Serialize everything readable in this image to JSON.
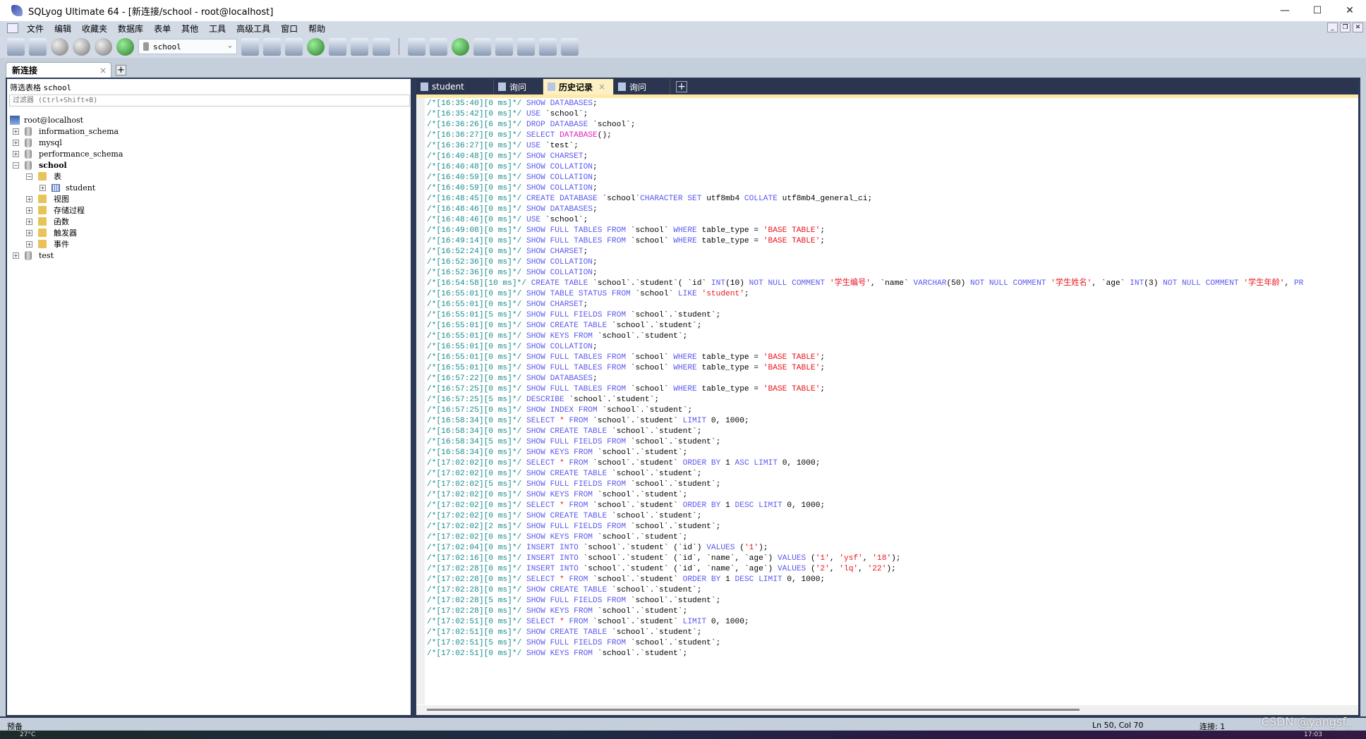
{
  "window": {
    "title": "SQLyog Ultimate 64 - [新连接/school - root@localhost]",
    "controls": [
      "—",
      "☐",
      "✕"
    ]
  },
  "menu": [
    "文件",
    "编辑",
    "收藏夹",
    "数据库",
    "表单",
    "其他",
    "工具",
    "高级工具",
    "窗口",
    "帮助"
  ],
  "toolbar": {
    "database_selector": "school"
  },
  "connection_tab": {
    "label": "新连接",
    "close": "×",
    "add": "+"
  },
  "left_panel": {
    "filter_label": "筛选表格",
    "filter_db": "school",
    "filter_placeholder": "过滤器 (Ctrl+Shift+B)",
    "tree": [
      {
        "label": "root@localhost",
        "level": 0,
        "icon": "server-icon",
        "exp": ""
      },
      {
        "label": "information_schema",
        "level": 1,
        "icon": "database-icon",
        "exp": "+"
      },
      {
        "label": "mysql",
        "level": 1,
        "icon": "database-icon",
        "exp": "+"
      },
      {
        "label": "performance_schema",
        "level": 1,
        "icon": "database-icon",
        "exp": "+"
      },
      {
        "label": "school",
        "level": 1,
        "icon": "database-icon",
        "exp": "−",
        "bold": true
      },
      {
        "label": "表",
        "level": 2,
        "icon": "folder-icon",
        "exp": "−"
      },
      {
        "label": "student",
        "level": 3,
        "icon": "table-icon",
        "exp": "+"
      },
      {
        "label": "视图",
        "level": 2,
        "icon": "folder-icon",
        "exp": "+"
      },
      {
        "label": "存储过程",
        "level": 2,
        "icon": "folder-icon",
        "exp": "+"
      },
      {
        "label": "函数",
        "level": 2,
        "icon": "folder-icon",
        "exp": "+"
      },
      {
        "label": "触发器",
        "level": 2,
        "icon": "folder-icon",
        "exp": "+"
      },
      {
        "label": "事件",
        "level": 2,
        "icon": "folder-icon",
        "exp": "+"
      },
      {
        "label": "test",
        "level": 1,
        "icon": "database-icon",
        "exp": "+"
      }
    ]
  },
  "query_tabs": [
    {
      "label": "student",
      "icon": "table-icon",
      "active": false
    },
    {
      "label": "询问",
      "icon": "query-icon",
      "active": false
    },
    {
      "label": "历史记录",
      "icon": "calendar-icon",
      "active": true,
      "close": "×"
    },
    {
      "label": "询问",
      "icon": "query-icon",
      "active": false
    }
  ],
  "history": [
    "/*[16:35:40][0 ms]*/ SHOW DATABASES;",
    "/*[16:35:42][0 ms]*/ USE `school`;",
    "/*[16:36:26][6 ms]*/ DROP DATABASE `school`;",
    "/*[16:36:27][0 ms]*/ SELECT DATABASE();",
    "/*[16:36:27][0 ms]*/ USE `test`;",
    "/*[16:40:48][0 ms]*/ SHOW CHARSET;",
    "/*[16:40:48][0 ms]*/ SHOW COLLATION;",
    "/*[16:40:59][0 ms]*/ SHOW COLLATION;",
    "/*[16:40:59][0 ms]*/ SHOW COLLATION;",
    "/*[16:48:45][0 ms]*/ CREATE DATABASE `school`CHARACTER SET utf8mb4 COLLATE utf8mb4_general_ci;",
    "/*[16:48:46][0 ms]*/ SHOW DATABASES;",
    "/*[16:48:46][0 ms]*/ USE `school`;",
    "/*[16:49:08][0 ms]*/ SHOW FULL TABLES FROM `school` WHERE table_type = 'BASE TABLE';",
    "/*[16:49:14][0 ms]*/ SHOW FULL TABLES FROM `school` WHERE table_type = 'BASE TABLE';",
    "/*[16:52:24][0 ms]*/ SHOW CHARSET;",
    "/*[16:52:36][0 ms]*/ SHOW COLLATION;",
    "/*[16:52:36][0 ms]*/ SHOW COLLATION;",
    "/*[16:54:58][10 ms]*/ CREATE TABLE `school`.`student`( `id` INT(10) NOT NULL COMMENT '学生编号', `name` VARCHAR(50) NOT NULL COMMENT '学生姓名', `age` INT(3) NOT NULL COMMENT '学生年龄', PR",
    "/*[16:55:01][0 ms]*/ SHOW TABLE STATUS FROM `school` LIKE 'student';",
    "/*[16:55:01][0 ms]*/ SHOW CHARSET;",
    "/*[16:55:01][5 ms]*/ SHOW FULL FIELDS FROM `school`.`student`;",
    "/*[16:55:01][0 ms]*/ SHOW CREATE TABLE `school`.`student`;",
    "/*[16:55:01][0 ms]*/ SHOW KEYS FROM `school`.`student`;",
    "/*[16:55:01][0 ms]*/ SHOW COLLATION;",
    "/*[16:55:01][0 ms]*/ SHOW FULL TABLES FROM `school` WHERE table_type = 'BASE TABLE';",
    "/*[16:55:01][0 ms]*/ SHOW FULL TABLES FROM `school` WHERE table_type = 'BASE TABLE';",
    "/*[16:57:22][0 ms]*/ SHOW DATABASES;",
    "/*[16:57:25][0 ms]*/ SHOW FULL TABLES FROM `school` WHERE table_type = 'BASE TABLE';",
    "/*[16:57:25][5 ms]*/ DESCRIBE `school`.`student`;",
    "/*[16:57:25][0 ms]*/ SHOW INDEX FROM `school`.`student`;",
    "/*[16:58:34][0 ms]*/ SELECT * FROM `school`.`student` LIMIT 0, 1000;",
    "/*[16:58:34][0 ms]*/ SHOW CREATE TABLE `school`.`student`;",
    "/*[16:58:34][5 ms]*/ SHOW FULL FIELDS FROM `school`.`student`;",
    "/*[16:58:34][0 ms]*/ SHOW KEYS FROM `school`.`student`;",
    "/*[17:02:02][0 ms]*/ SELECT * FROM `school`.`student` ORDER BY 1 ASC LIMIT 0, 1000;",
    "/*[17:02:02][0 ms]*/ SHOW CREATE TABLE `school`.`student`;",
    "/*[17:02:02][5 ms]*/ SHOW FULL FIELDS FROM `school`.`student`;",
    "/*[17:02:02][0 ms]*/ SHOW KEYS FROM `school`.`student`;",
    "/*[17:02:02][0 ms]*/ SELECT * FROM `school`.`student` ORDER BY 1 DESC LIMIT 0, 1000;",
    "/*[17:02:02][0 ms]*/ SHOW CREATE TABLE `school`.`student`;",
    "/*[17:02:02][2 ms]*/ SHOW FULL FIELDS FROM `school`.`student`;",
    "/*[17:02:02][0 ms]*/ SHOW KEYS FROM `school`.`student`;",
    "/*[17:02:04][0 ms]*/ INSERT INTO `school`.`student` (`id`) VALUES ('1');",
    "/*[17:02:16][0 ms]*/ INSERT INTO `school`.`student` (`id`, `name`, `age`) VALUES ('1', 'ysf', '18');",
    "/*[17:02:28][0 ms]*/ INSERT INTO `school`.`student` (`id`, `name`, `age`) VALUES ('2', 'lq', '22');",
    "/*[17:02:28][0 ms]*/ SELECT * FROM `school`.`student` ORDER BY 1 DESC LIMIT 0, 1000;",
    "/*[17:02:28][0 ms]*/ SHOW CREATE TABLE `school`.`student`;",
    "/*[17:02:28][5 ms]*/ SHOW FULL FIELDS FROM `school`.`student`;",
    "/*[17:02:28][0 ms]*/ SHOW KEYS FROM `school`.`student`;",
    "/*[17:02:51][0 ms]*/ SELECT * FROM `school`.`student` LIMIT 0, 1000;",
    "/*[17:02:51][0 ms]*/ SHOW CREATE TABLE `school`.`student`;",
    "/*[17:02:51][5 ms]*/ SHOW FULL FIELDS FROM `school`.`student`;",
    "/*[17:02:51][0 ms]*/ SHOW KEYS FROM `school`.`student`;"
  ],
  "colors": {
    "comment": "#178b8b",
    "keyword": "#5a5af0",
    "string": "#e8151d",
    "function": "#e020c0"
  },
  "status": {
    "left": "预备",
    "position": "Ln 50, Col 70",
    "connections": "连接: 1"
  },
  "taskbar": {
    "weather": "27°C",
    "clock": "17:03"
  },
  "watermark": "CSDN @yangsf_"
}
